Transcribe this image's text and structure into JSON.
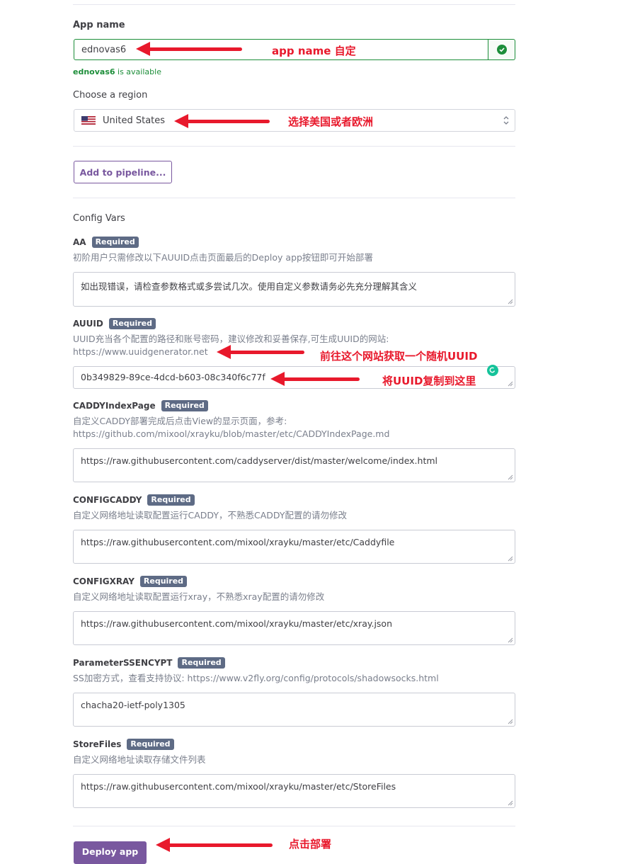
{
  "app_name": {
    "label": "App name",
    "value": "ednovas6",
    "availability_name": "ednovas6",
    "availability_text": " is available"
  },
  "region": {
    "label": "Choose a region",
    "value": "United States"
  },
  "pipeline": {
    "button_label": "Add to pipeline..."
  },
  "config": {
    "heading": "Config Vars",
    "required_label": "Required",
    "vars": [
      {
        "name": "AA",
        "desc": "初阶用户只需修改以下AUUID点击页面最后的Deploy app按钮即可开始部署",
        "value": "如出现错误，请检查参数格式或多尝试几次。使用自定义参数请务必先充分理解其含义"
      },
      {
        "name": "AUUID",
        "desc": "UUID充当各个配置的路径和账号密码，建议修改和妥善保存,可生成UUID的网站:",
        "desc2": "https://www.uuidgenerator.net",
        "value": "0b349829-89ce-4dcd-b603-08c340f6c77f"
      },
      {
        "name": "CADDYIndexPage",
        "desc": "自定义CADDY部署完成后点击View的显示页面，参考:",
        "desc2": "https://github.com/mixool/xrayku/blob/master/etc/CADDYIndexPage.md",
        "value": "https://raw.githubusercontent.com/caddyserver/dist/master/welcome/index.html"
      },
      {
        "name": "CONFIGCADDY",
        "desc": "自定义网络地址读取配置运行CADDY，不熟悉CADDY配置的请勿修改",
        "value": "https://raw.githubusercontent.com/mixool/xrayku/master/etc/Caddyfile"
      },
      {
        "name": "CONFIGXRAY",
        "desc": "自定义网络地址读取配置运行xray，不熟悉xray配置的请勿修改",
        "value": "https://raw.githubusercontent.com/mixool/xrayku/master/etc/xray.json"
      },
      {
        "name": "ParameterSSENCYPT",
        "desc": "SS加密方式，查看支持协议: https://www.v2fly.org/config/protocols/shadowsocks.html",
        "value": "chacha20-ietf-poly1305"
      },
      {
        "name": "StoreFiles",
        "desc": "自定义网络地址读取存储文件列表",
        "value": "https://raw.githubusercontent.com/mixool/xrayku/master/etc/StoreFiles"
      }
    ]
  },
  "deploy": {
    "button_label": "Deploy app"
  },
  "annotations": {
    "app_name": "app name 自定",
    "region": "选择美国或者欧洲",
    "uuid_site": "前往这个网站获取一个随机UUID",
    "uuid_paste": "将UUID复制到这里",
    "deploy": "点击部署"
  },
  "colors": {
    "accent": "#79589f",
    "success": "#1d8e3a",
    "annotation": "#e8192c",
    "badge": "#5e6b85"
  },
  "icons": [
    "check-circle-icon",
    "us-flag-icon",
    "select-chevron-icon",
    "resize-grip-icon",
    "grammarly-icon"
  ]
}
